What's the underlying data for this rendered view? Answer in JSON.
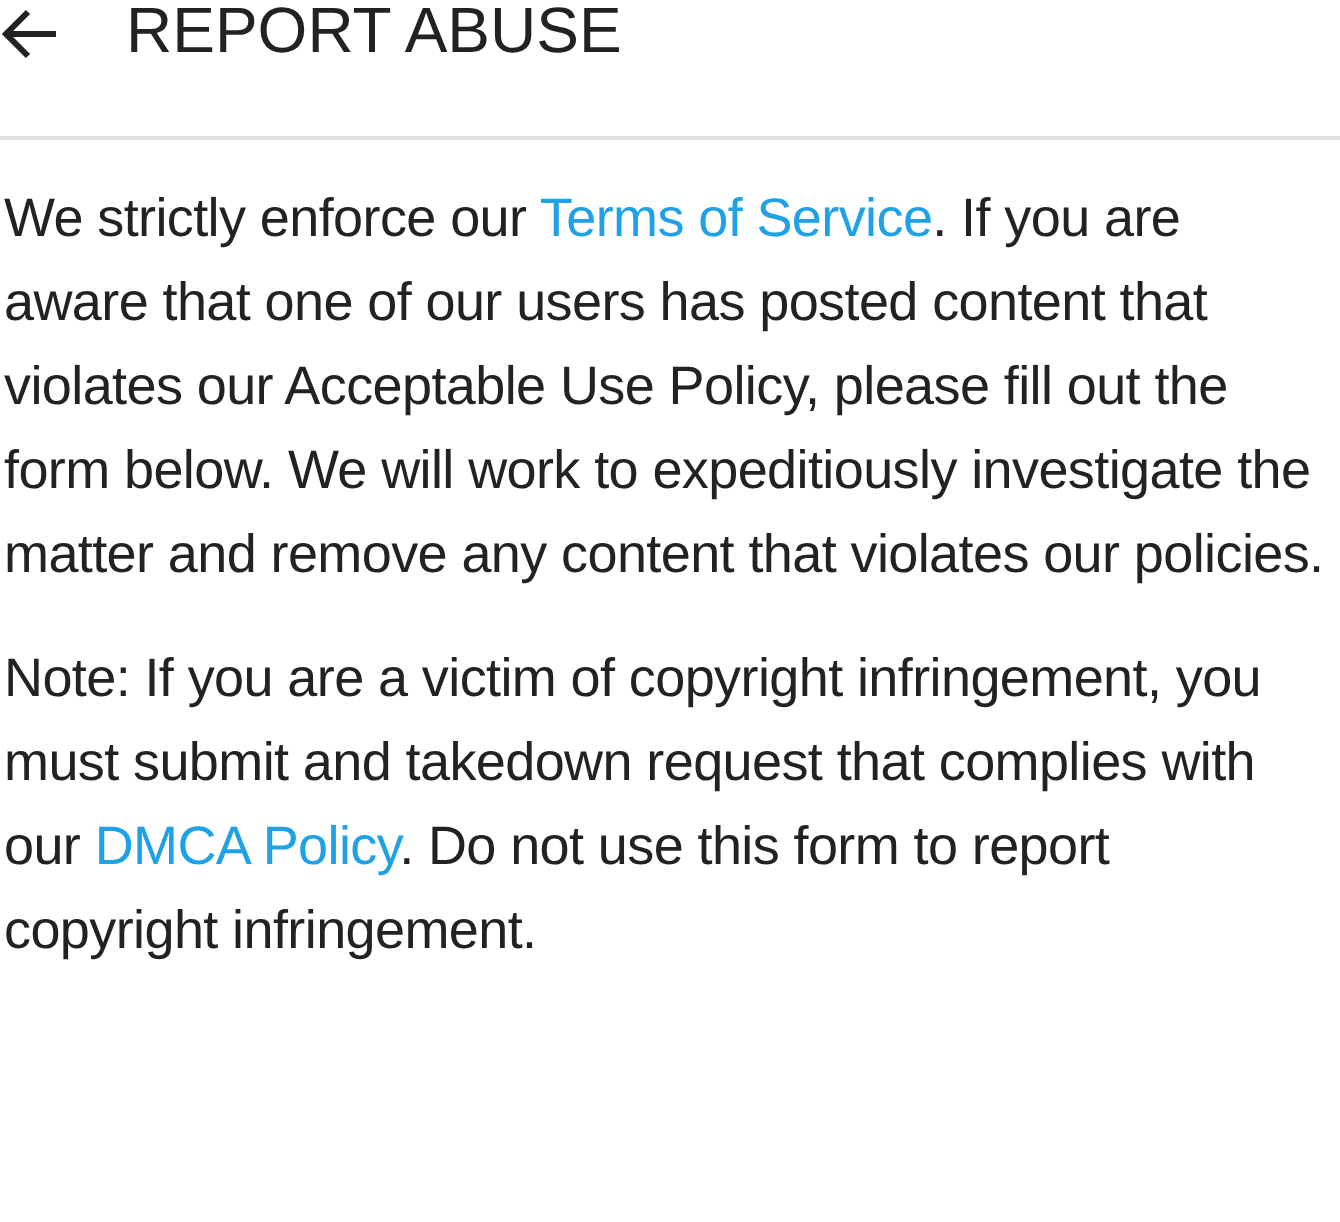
{
  "header": {
    "title": "REPORT ABUSE"
  },
  "paragraphs": [
    [
      {
        "kind": "text",
        "text": "We strictly enforce our "
      },
      {
        "kind": "link",
        "text": "Terms of Service"
      },
      {
        "kind": "text",
        "text": ". If you are aware that one of our users has posted content that violates our Acceptable Use Policy, please fill out the form below. We will work to expeditiously investigate the matter and remove any content that violates our policies."
      }
    ],
    [
      {
        "kind": "text",
        "text": "Note: If you are a victim of copyright infringement, you must submit and takedown request that complies with our "
      },
      {
        "kind": "link",
        "text": "DMCA Policy"
      },
      {
        "kind": "text",
        "text": ". Do not use this form to report copyright infringement."
      }
    ]
  ]
}
